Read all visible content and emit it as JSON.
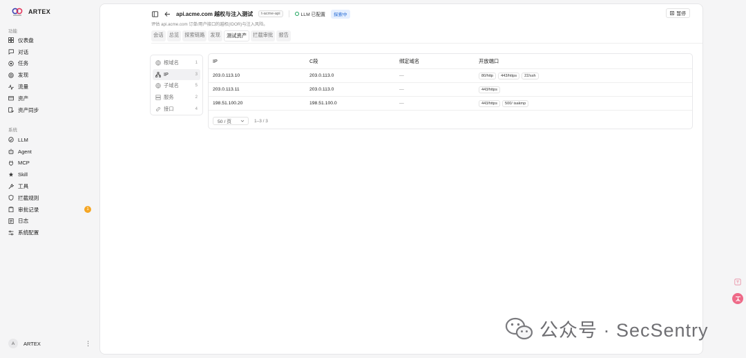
{
  "brand": {
    "name": "ARTEX"
  },
  "sidebar": {
    "section_function": "功能",
    "section_system": "系统",
    "function_items": [
      {
        "label": "仪表盘",
        "icon": "dashboard-icon"
      },
      {
        "label": "对话",
        "icon": "chat-icon"
      },
      {
        "label": "任务",
        "icon": "task-icon"
      },
      {
        "label": "发现",
        "icon": "discover-icon"
      },
      {
        "label": "流量",
        "icon": "traffic-icon"
      },
      {
        "label": "资产",
        "icon": "asset-icon"
      },
      {
        "label": "资产同步",
        "icon": "asset-sync-icon"
      }
    ],
    "system_items": [
      {
        "label": "LLM",
        "icon": "llm-icon"
      },
      {
        "label": "Agent",
        "icon": "agent-icon"
      },
      {
        "label": "MCP",
        "icon": "mcp-icon"
      },
      {
        "label": "Skill",
        "icon": "skill-icon"
      },
      {
        "label": "工具",
        "icon": "tool-icon"
      },
      {
        "label": "拦截规则",
        "icon": "shield-icon"
      },
      {
        "label": "审批记录",
        "icon": "clipboard-icon",
        "badge": "1"
      },
      {
        "label": "日志",
        "icon": "log-icon"
      },
      {
        "label": "系统配置",
        "icon": "settings-icon"
      }
    ],
    "user": {
      "avatar": "A",
      "name": "ARTEX",
      "menu": "⋮"
    }
  },
  "header": {
    "title": "api.acme.com 越权与注入测试",
    "tag": "t-acme-api",
    "llm_status": "LLM 已配置",
    "status": "探索中",
    "pause_label": "暂停",
    "description": "评估 api.acme.com 订单/用户接口的越权(IDOR)与注入风险。"
  },
  "tabs": [
    "会话",
    "总览",
    "探索链路",
    "发现",
    "测试资产",
    "拦截审批",
    "报告"
  ],
  "active_tab": "测试资产",
  "asset_filter": [
    {
      "label": "根域名",
      "count": "1",
      "icon": "globe-icon"
    },
    {
      "label": "IP",
      "count": "3",
      "icon": "network-icon",
      "active": true
    },
    {
      "label": "子域名",
      "count": "5",
      "icon": "globe-icon"
    },
    {
      "label": "服务",
      "count": "2",
      "icon": "server-icon"
    },
    {
      "label": "接口",
      "count": "4",
      "icon": "link-icon"
    }
  ],
  "table": {
    "columns": [
      "IP",
      "C段",
      "绑定域名",
      "开放端口"
    ],
    "rows": [
      {
        "ip": "203.0.113.10",
        "c_segment": "203.0.113.0",
        "domain": "—",
        "ports": [
          "80/http",
          "443/https",
          "22/ssh"
        ]
      },
      {
        "ip": "203.0.113.11",
        "c_segment": "203.0.113.0",
        "domain": "—",
        "ports": [
          "443/https"
        ]
      },
      {
        "ip": "198.51.100.20",
        "c_segment": "198.51.100.0",
        "domain": "—",
        "ports": [
          "443/https",
          "500/ isakmp"
        ]
      }
    ],
    "page_size": "50 / 页",
    "range": "1–3 / 3"
  },
  "watermark": "公众号 · SecSentry",
  "colors": {
    "accent_blue": "#2b6fd6",
    "badge_orange": "#f5a623",
    "llm_green": "#19a35a",
    "float_pink": "#ee6a88"
  }
}
